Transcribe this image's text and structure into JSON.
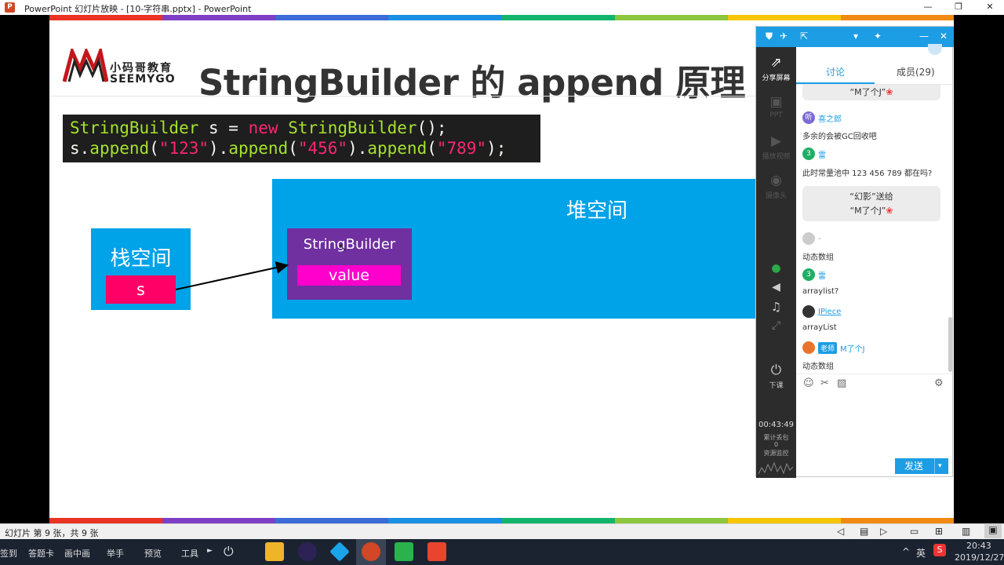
{
  "window": {
    "title": "PowerPoint 幻灯片放映 - [10-字符串.pptx] - PowerPoint",
    "ppt_icon": "P"
  },
  "slide": {
    "logo_cn": "小码哥教育",
    "logo_en": "SEEMYGO",
    "title": "StringBuilder 的 append 原理",
    "code": {
      "line1": {
        "type": "StringBuilder",
        "var": " s = ",
        "kw": "new",
        "ctor": "StringBuilder",
        "end": "();"
      },
      "line2": {
        "s": "s.",
        "fn1": "append",
        "p1a": "(",
        "a1": "\"123\"",
        "p1b": ").",
        "fn2": "append",
        "p2a": "(",
        "a2": "\"456\"",
        "p2b": ").",
        "fn3": "append",
        "p3a": "(",
        "a3": "\"789\"",
        "p3b": ");"
      }
    },
    "heap_label": "堆空间",
    "stack_label": "栈空间",
    "sb_label": "StringBuilder",
    "value_label": "value",
    "s_label": "s"
  },
  "chat": {
    "sidebar": [
      {
        "icon": "share-screen-icon",
        "label": "分享屏幕"
      },
      {
        "icon": "ppt-icon",
        "label": "PPT"
      },
      {
        "icon": "play-video-icon",
        "label": "播放视频"
      },
      {
        "icon": "camera-icon",
        "label": "摄像头"
      },
      {
        "icon": "end-class-icon",
        "label": "下课"
      }
    ],
    "timer": "00:43:49",
    "stats_line1": "累计丢包",
    "stats_line2": "0",
    "stats_line3": "资源监控",
    "tabs": {
      "discussion": "讨论",
      "members": "成员(29)"
    },
    "messages": {
      "gift1_line2": "“M了个J”",
      "nick1": "喜之郎",
      "msg1": "多余的会被GC回收吧",
      "nick2": "雷",
      "msg2": "此时常量池中 123 456 789 都在吗?",
      "gift2_line1": "“幻影”送给",
      "gift2_line2": "“M了个J”",
      "nick3": "-",
      "msg3": "动态数组",
      "nick4": "雷",
      "msg4": "arraylist?",
      "nick5": "JPiece",
      "msg5": "arrayList",
      "teacher_badge": "老师",
      "nick6": "M了个J",
      "msg6": "动态数组"
    },
    "send_label": "发送"
  },
  "statusbar": {
    "slide_info": "幻灯片 第 9 张，共 9 张"
  },
  "taskbar": {
    "items": [
      "签到",
      "答题卡",
      "画中画",
      "举手",
      "预览",
      "工具"
    ],
    "ime": "英",
    "time": "20:43",
    "date": "2019/12/27"
  },
  "colors": {
    "accent": "#1d9de3",
    "heap": "#00a2e8",
    "sb": "#7030a0",
    "value": "#ff00cc",
    "s_box": "#ff0066"
  }
}
